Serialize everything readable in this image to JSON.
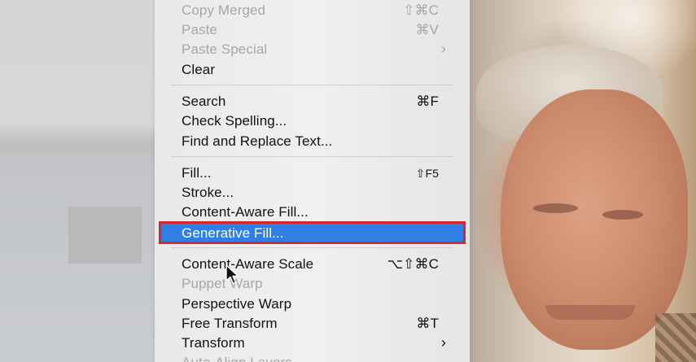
{
  "menu": {
    "items": [
      {
        "label": "Copy Merged",
        "shortcut": "⇧⌘C",
        "disabled": true
      },
      {
        "label": "Paste",
        "shortcut": "⌘V",
        "disabled": true
      },
      {
        "label": "Paste Special",
        "submenu_arrow": "›",
        "disabled": true
      },
      {
        "label": "Clear",
        "disabled": false
      },
      {
        "label": "Search",
        "shortcut": "⌘F",
        "disabled": false
      },
      {
        "label": "Check Spelling...",
        "disabled": false
      },
      {
        "label": "Find and Replace Text...",
        "disabled": false
      },
      {
        "label": "Fill...",
        "shortcut": "⇧F5",
        "disabled": false
      },
      {
        "label": "Stroke...",
        "disabled": false
      },
      {
        "label": "Content-Aware Fill...",
        "disabled": false
      },
      {
        "label": "Generative Fill...",
        "highlighted": true
      },
      {
        "label": "Content-Aware Scale",
        "shortcut": "⌥⇧⌘C",
        "disabled": false
      },
      {
        "label": "Puppet Warp",
        "disabled": true
      },
      {
        "label": "Perspective Warp",
        "disabled": false
      },
      {
        "label": "Free Transform",
        "shortcut": "⌘T",
        "disabled": false
      },
      {
        "label": "Transform",
        "submenu_arrow": "›",
        "disabled": false
      },
      {
        "label": "Auto-Align Layers",
        "disabled": true
      }
    ]
  },
  "colors": {
    "highlight_bg": "#2f7fe6",
    "highlight_border": "#d62a2a",
    "disabled_text": "#a9a7a6"
  },
  "icons": {
    "cursor": "arrow-pointer-icon"
  }
}
